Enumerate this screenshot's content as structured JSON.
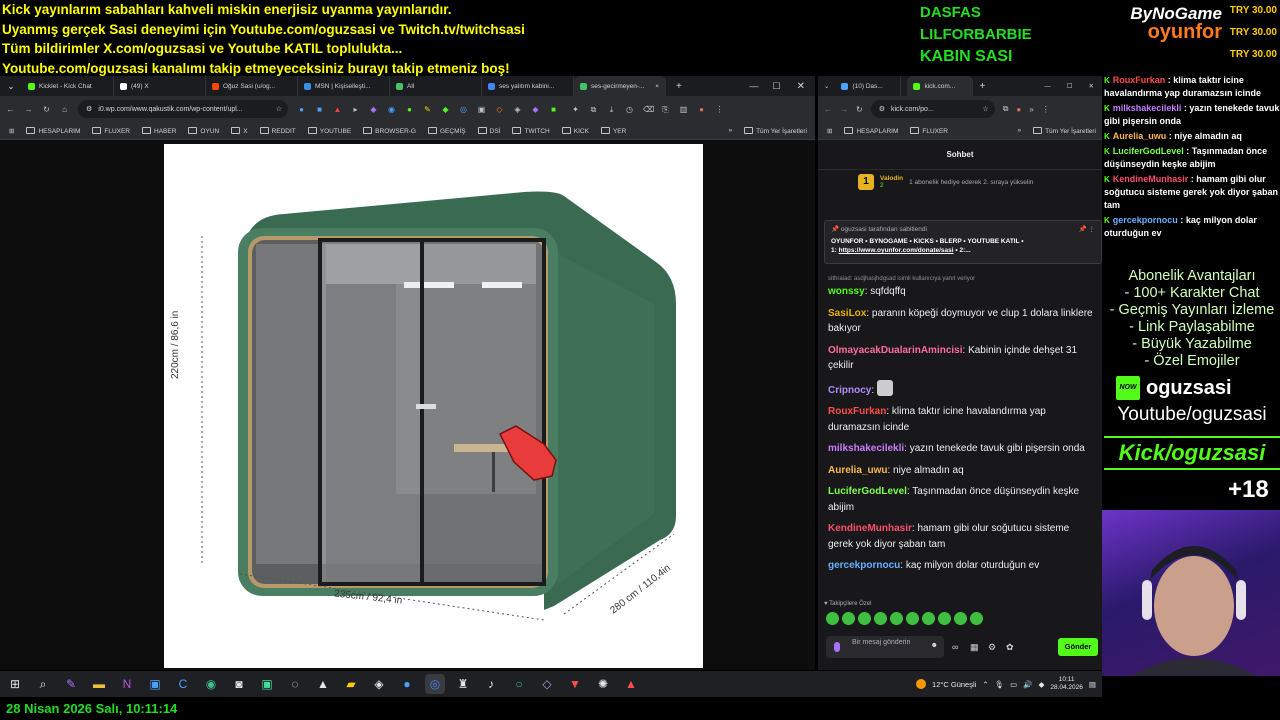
{
  "overlay": {
    "lines": [
      "Kick yayınlarım sabahları kahveli miskin enerjisiz uyanma yayınlarıdır.",
      "Uyanmış gerçek Sasi deneyimi için Youtube.com/oguzsasi ve Twitch.tv/twitchsasi",
      "Tüm bildirimler X.com/oguzsasi ve Youtube KATIL toplulukta...",
      "Youtube.com/oguzsasi kanalımı takip etmeyeceksiniz burayı takip etmeniz boş!"
    ],
    "names": [
      "DASFAS",
      "LILFORBARBIE",
      "KABIN SASI"
    ],
    "logo_top": "ByNoGame",
    "logo_bottom": "oyunfor",
    "donations": [
      "TRY 30.00",
      "TRY 30.00",
      "TRY 30.00"
    ],
    "date_line": "28 Nisan 2026 Salı, 10:11:14"
  },
  "browser1": {
    "tabs": [
      "Kicklet - Kick Chat",
      "(49) X",
      "Oğuz Sasi (u/og...",
      "MSN | Kişiselleşti...",
      "All",
      "ses yalıtım kabini...",
      "ses-gecirmeyen-..."
    ],
    "url": "i0.wp.com/www.qakustik.com/wp-content/upl...",
    "bookmarks": [
      "HESAPLARIM",
      "FLUXER",
      "HABER",
      "OYUN",
      "X",
      "REDDIT",
      "YOUTUBE",
      "BROWSER-G",
      "GEÇMİŞ",
      "DSİ",
      "TWITCH",
      "KICK",
      "YER"
    ],
    "all_bookmarks": "Tüm Yer İşaretleri",
    "photo": {
      "height_label": "220cm / 86,6 in",
      "width_label": "235cm / 92,4 in",
      "depth_label": "280 cm / 110,4in"
    }
  },
  "browser2": {
    "tabs": [
      "(10) Das...",
      "kick.com..."
    ],
    "url": "kick.com/po...",
    "bookmarks": [
      "HESAPLARIM",
      "FLUXER"
    ],
    "all_bookmarks": "Tüm Yer İşaretleri",
    "chat": {
      "title": "Sohbet",
      "gift_user": "Valodin",
      "gift_count": "2",
      "gift_rank": "1",
      "gift_text": "1 abonelik hediye ederek 2. sıraya yükselin",
      "pinned_by": "oguzsasi tarafından sabitlendi",
      "pinned_text": "OYUNFOR • BYNOGAME • KICKS • BLERP • YOUTUBE KATIL •",
      "pinned_link_prefix": "1: ",
      "pinned_link": "https://www.oyunfor.com/donate/sasi",
      "pinned_link_suffix": " • 2:...",
      "reply_hint": "sithraiad: asdjhasjhdgsad isimli kullanıcıya yanıt veriyor",
      "messages": [
        {
          "user": "wonssy",
          "text": "sqfdqffq",
          "color": "#53fc18"
        },
        {
          "user": "SasiLox",
          "text": "paranın köpeği doymuyor ve clup 1 dolara linklere bakıyor",
          "color": "#e8b400"
        },
        {
          "user": "OlmayacakDualarinAmincisi",
          "text": "Kabinin içinde dehşet 31 çekilir",
          "color": "#ff6b9a"
        },
        {
          "user": "Cripnocy",
          "text": "",
          "color": "#b18cff"
        },
        {
          "user": "RouxFurkan",
          "text": "klima taktır icine havalandırma yap duramazsın icinde",
          "color": "#ff4d4d"
        },
        {
          "user": "milkshakecilekli",
          "text": "yazın tenekede tavuk gibi pişersin onda",
          "color": "#c77dff"
        },
        {
          "user": "Aurelia_uwu",
          "text": "niye almadın aq",
          "color": "#ffb84d"
        },
        {
          "user": "LuciferGodLevel",
          "text": "Taşınmadan önce düşünseydin keşke abijim",
          "color": "#7cff4d"
        },
        {
          "user": "KendineMunhasir",
          "text": "hamam gibi olur soğutucu sisteme gerek yok diyor şaban tam",
          "color": "#ff4d6d"
        },
        {
          "user": "gercekpornocu",
          "text": "kaç milyon dolar oturduğun ev",
          "color": "#6ab0ff"
        }
      ],
      "followers_only": "Takipçilere Özel",
      "input_placeholder": "Bir mesaj gönderin",
      "send": "Gönder"
    }
  },
  "side": {
    "messages": [
      {
        "user": "RouxFurkan",
        "text": "klima taktır icine havalandırma yap duramazsın icinde",
        "color": "#ff4d4d"
      },
      {
        "user": "milkshakecilekli",
        "text": "yazın tenekede tavuk gibi pişersin onda",
        "color": "#c77dff"
      },
      {
        "user": "Aurelia_uwu",
        "text": "niye almadın aq",
        "color": "#ffb84d"
      },
      {
        "user": "LuciferGodLevel",
        "text": "Taşınmadan önce düşünseydin keşke abijim",
        "color": "#7cff4d"
      },
      {
        "user": "KendineMunhasir",
        "text": "hamam gibi olur soğutucu sisteme gerek yok diyor şaban tam",
        "color": "#ff4d6d"
      },
      {
        "user": "gercekpornocu",
        "text": "kaç milyon dolar oturduğun ev",
        "color": "#6ab0ff"
      }
    ],
    "perks": [
      "Abonelik Avantajları",
      "- 100+ Karakter Chat",
      "- Geçmiş Yayınları İzleme",
      "- Link Paylaşabilme",
      "- Büyük Yazabilme",
      "- Özel Emojiler"
    ],
    "now_badge": "NOW",
    "kick_name": "oguzsasi",
    "youtube": "Youtube/oguzsasi",
    "kick_banner": "Kick/oguzsasi",
    "age": "+18"
  },
  "taskbar": {
    "weather": "12°C  Güneşli",
    "time": "10:11",
    "date": "28.04.2026"
  }
}
